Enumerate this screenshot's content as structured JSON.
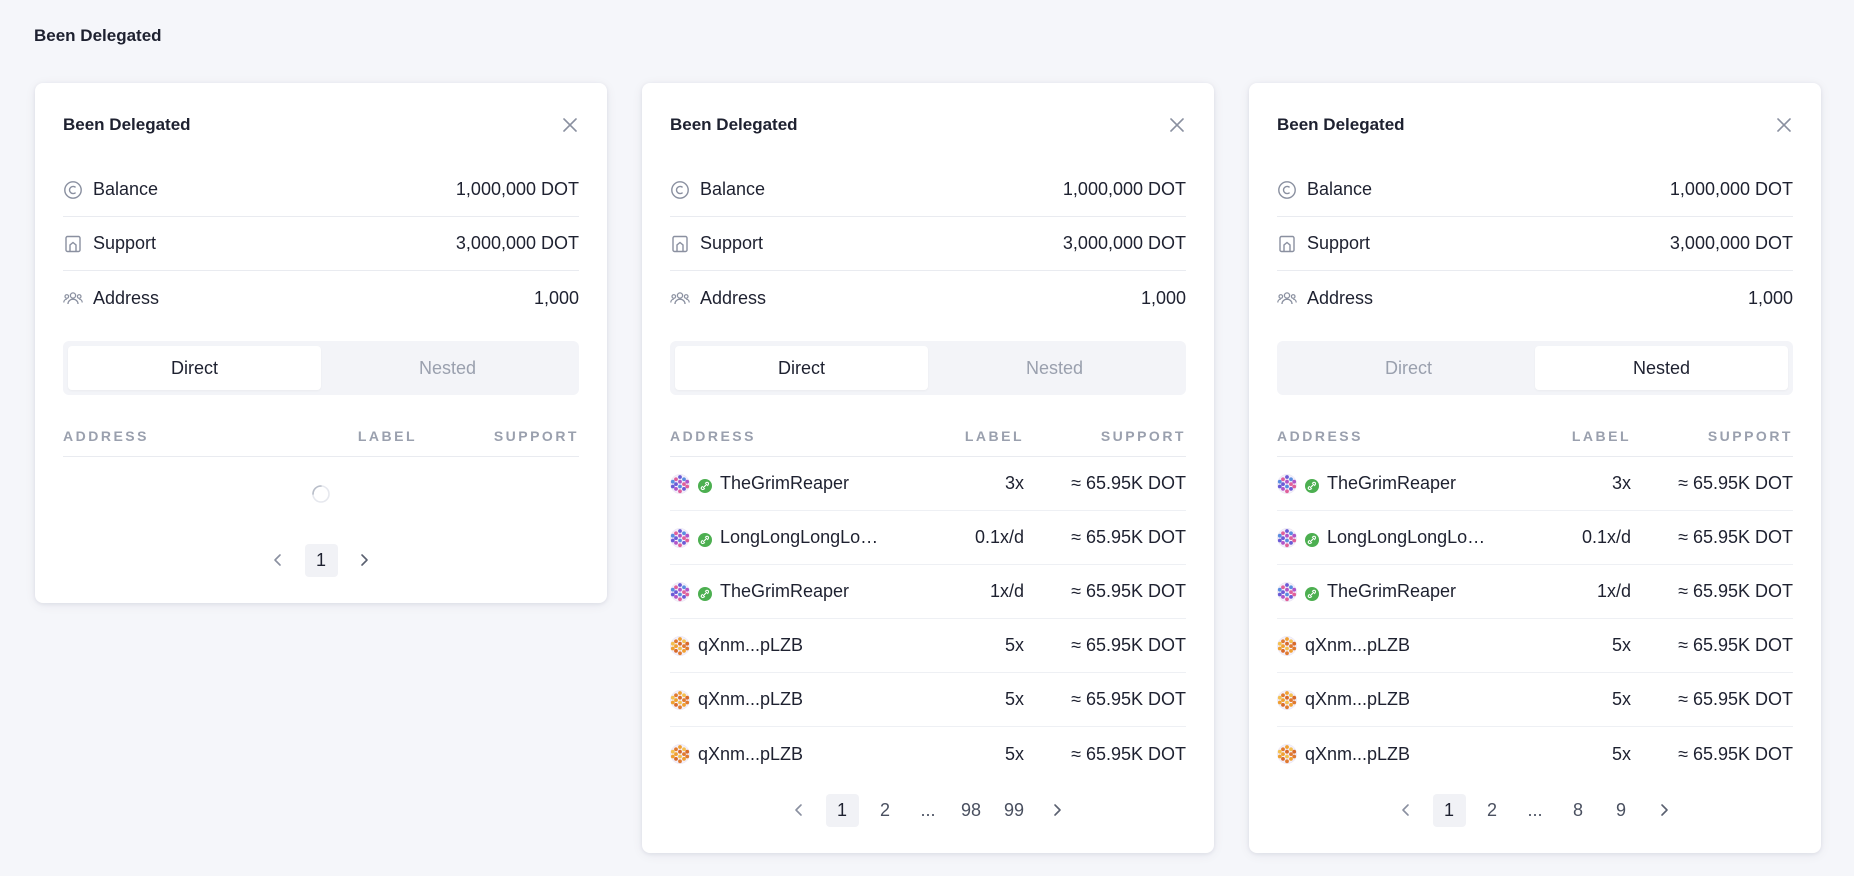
{
  "page": {
    "title": "Been Delegated"
  },
  "colors": {
    "accent_green": "#4caf50",
    "muted": "#9aa0ae",
    "text": "#1e2130"
  },
  "cards": [
    {
      "title": "Been Delegated",
      "stats": [
        {
          "label": "Balance",
          "value": "1,000,000 DOT",
          "icon": "coin-icon"
        },
        {
          "label": "Support",
          "value": "3,000,000 DOT",
          "icon": "bookmark-icon"
        },
        {
          "label": "Address",
          "value": "1,000",
          "icon": "users-icon"
        }
      ],
      "tabs": [
        {
          "label": "Direct",
          "active": true
        },
        {
          "label": "Nested",
          "active": false
        }
      ],
      "columns": {
        "address": "ADDRESS",
        "label": "LABEL",
        "support": "SUPPORT"
      },
      "loading": true,
      "rows": [],
      "pages": [
        "1"
      ],
      "current_page": "1"
    },
    {
      "title": "Been Delegated",
      "stats": [
        {
          "label": "Balance",
          "value": "1,000,000 DOT",
          "icon": "coin-icon"
        },
        {
          "label": "Support",
          "value": "3,000,000 DOT",
          "icon": "bookmark-icon"
        },
        {
          "label": "Address",
          "value": "1,000",
          "icon": "users-icon"
        }
      ],
      "tabs": [
        {
          "label": "Direct",
          "active": true
        },
        {
          "label": "Nested",
          "active": false
        }
      ],
      "columns": {
        "address": "ADDRESS",
        "label": "LABEL",
        "support": "SUPPORT"
      },
      "loading": false,
      "rows": [
        {
          "address": "TheGrimReaper",
          "verified": true,
          "avatar": "purple",
          "label": "3x",
          "support": "≈ 65.95K DOT"
        },
        {
          "address": "LongLongLongLongL...",
          "verified": true,
          "avatar": "purple",
          "label": "0.1x/d",
          "support": "≈ 65.95K DOT"
        },
        {
          "address": "TheGrimReaper",
          "verified": true,
          "avatar": "purple",
          "label": "1x/d",
          "support": "≈ 65.95K DOT"
        },
        {
          "address": "qXnm...pLZB",
          "verified": false,
          "avatar": "orange",
          "label": "5x",
          "support": "≈ 65.95K DOT"
        },
        {
          "address": "qXnm...pLZB",
          "verified": false,
          "avatar": "orange",
          "label": "5x",
          "support": "≈ 65.95K DOT"
        },
        {
          "address": "qXnm...pLZB",
          "verified": false,
          "avatar": "orange",
          "label": "5x",
          "support": "≈ 65.95K DOT"
        }
      ],
      "pages": [
        "1",
        "2",
        "...",
        "98",
        "99"
      ],
      "current_page": "1"
    },
    {
      "title": "Been Delegated",
      "stats": [
        {
          "label": "Balance",
          "value": "1,000,000 DOT",
          "icon": "coin-icon"
        },
        {
          "label": "Support",
          "value": "3,000,000 DOT",
          "icon": "bookmark-icon"
        },
        {
          "label": "Address",
          "value": "1,000",
          "icon": "users-icon"
        }
      ],
      "tabs": [
        {
          "label": "Direct",
          "active": false
        },
        {
          "label": "Nested",
          "active": true
        }
      ],
      "columns": {
        "address": "ADDRESS",
        "label": "LABEL",
        "support": "SUPPORT"
      },
      "loading": false,
      "rows": [
        {
          "address": "TheGrimReaper",
          "verified": true,
          "avatar": "purple",
          "label": "3x",
          "support": "≈ 65.95K DOT"
        },
        {
          "address": "LongLongLongLongL...",
          "verified": true,
          "avatar": "purple",
          "label": "0.1x/d",
          "support": "≈ 65.95K DOT"
        },
        {
          "address": "TheGrimReaper",
          "verified": true,
          "avatar": "purple",
          "label": "1x/d",
          "support": "≈ 65.95K DOT"
        },
        {
          "address": "qXnm...pLZB",
          "verified": false,
          "avatar": "orange",
          "label": "5x",
          "support": "≈ 65.95K DOT"
        },
        {
          "address": "qXnm...pLZB",
          "verified": false,
          "avatar": "orange",
          "label": "5x",
          "support": "≈ 65.95K DOT"
        },
        {
          "address": "qXnm...pLZB",
          "verified": false,
          "avatar": "orange",
          "label": "5x",
          "support": "≈ 65.95K DOT"
        }
      ],
      "pages": [
        "1",
        "2",
        "...",
        "8",
        "9"
      ],
      "current_page": "1"
    }
  ]
}
